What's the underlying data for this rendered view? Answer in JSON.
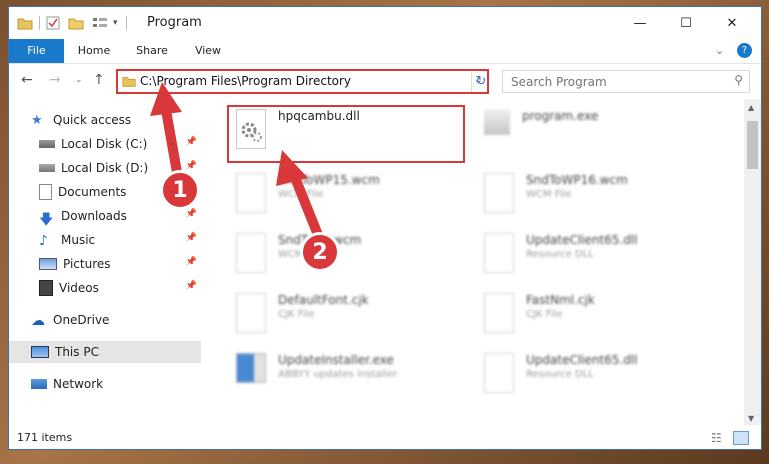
{
  "window": {
    "title": "Program",
    "minimize": "—",
    "maximize": "☐",
    "close": "✕"
  },
  "ribbon": {
    "tabs": [
      "File",
      "Home",
      "Share",
      "View"
    ]
  },
  "address": {
    "path": "C:\\Program Files\\Program Directory"
  },
  "search": {
    "placeholder": "Search Program"
  },
  "sidebar": {
    "items": [
      {
        "label": "Quick access"
      },
      {
        "label": "Local Disk (C:)"
      },
      {
        "label": "Local Disk (D:)"
      },
      {
        "label": "Documents"
      },
      {
        "label": "Downloads"
      },
      {
        "label": "Music"
      },
      {
        "label": "Pictures"
      },
      {
        "label": "Videos"
      },
      {
        "label": "OneDrive"
      },
      {
        "label": "This PC"
      },
      {
        "label": "Network"
      }
    ]
  },
  "files": [
    {
      "name": "hpqcambu.dll",
      "type": ""
    },
    {
      "name": "program.exe",
      "type": ""
    },
    {
      "name": "SndToWP15.wcm",
      "type": "WCM File"
    },
    {
      "name": "SndToWP16.wcm",
      "type": "WCM File"
    },
    {
      "name": "SndToX6.wcm",
      "type": "WCM File"
    },
    {
      "name": "UpdateClient65.dll",
      "type": "Resource DLL"
    },
    {
      "name": "DefaultFont.cjk",
      "type": "CJK File"
    },
    {
      "name": "FastNml.cjk",
      "type": "CJK File"
    },
    {
      "name": "UpdateInstaller.exe",
      "type": "ABBYY updates installer"
    },
    {
      "name": "UpdateClient65.dll",
      "type": "Resource DLL"
    }
  ],
  "status": {
    "count": "171 items"
  },
  "annotations": {
    "one": "1",
    "two": "2"
  },
  "colors": {
    "accent": "#1979ca",
    "callout": "#d9383a"
  }
}
